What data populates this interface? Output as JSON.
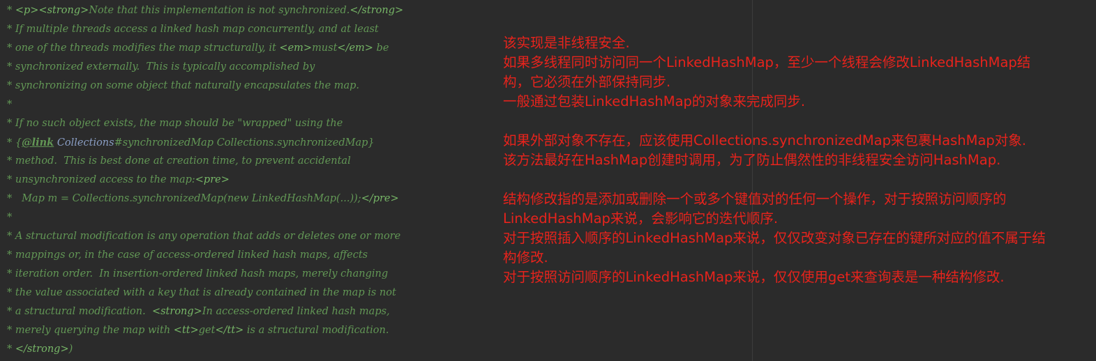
{
  "code_lines": [
    [
      "* ",
      {
        "t": "<p>",
        "c": "tag"
      },
      {
        "t": "<strong>",
        "c": "tag"
      },
      "Note that this implementation is not synchronized.",
      {
        "t": "</strong>",
        "c": "tag"
      }
    ],
    [
      "* If multiple threads access a linked hash map concurrently, and at least"
    ],
    [
      "* one of the threads modifies the map structurally, it ",
      {
        "t": "<em>",
        "c": "tag"
      },
      "must",
      {
        "t": "</em>",
        "c": "tag"
      },
      " be"
    ],
    [
      "* synchronized externally.  This is typically accomplished by"
    ],
    [
      "* synchronizing on some object that naturally encapsulates the map."
    ],
    [
      "*"
    ],
    [
      "* If no such object exists, the map should be \"wrapped\" using the"
    ],
    [
      "* {",
      {
        "t": "@link",
        "c": "linktag"
      },
      " ",
      {
        "t": "Collections",
        "c": "ref"
      },
      "#synchronizedMap Collections.synchronizedMap}"
    ],
    [
      "* method.  This is best done at creation time, to prevent accidental"
    ],
    [
      "* unsynchronized access to the map:",
      {
        "t": "<pre>",
        "c": "tag"
      }
    ],
    [
      "*   Map m = Collections.synchronizedMap(new LinkedHashMap(...));",
      {
        "t": "</pre>",
        "c": "tag"
      }
    ],
    [
      "*"
    ],
    [
      "* A structural modification is any operation that adds or deletes one or more"
    ],
    [
      "* mappings or, in the case of access-ordered linked hash maps, affects"
    ],
    [
      "* iteration order.  In insertion-ordered linked hash maps, merely changing"
    ],
    [
      "* the value associated with a key that is already contained in the map is not"
    ],
    [
      "* a structural modification.  ",
      {
        "t": "<strong>",
        "c": "tag"
      },
      "In access-ordered linked hash maps,"
    ],
    [
      "* merely querying the map with ",
      {
        "t": "<tt>",
        "c": "tag"
      },
      "get",
      {
        "t": "</tt>",
        "c": "tag"
      },
      " is a structural modification."
    ],
    [
      "* ",
      {
        "t": "</strong>",
        "c": "tag"
      },
      ")"
    ]
  ],
  "annotation_lines": [
    "该实现是非线程安全.",
    "如果多线程同时访问同一个LinkedHashMap，至少一个线程会修改LinkedHashMap结",
    "构，它必须在外部保持同步.",
    "一般通过包装LinkedHashMap的对象来完成同步.",
    "",
    "如果外部对象不存在，应该使用Collections.synchronizedMap来包裹HashMap对象.",
    "该方法最好在HashMap创建时调用，为了防止偶然性的非线程安全访问HashMap.",
    "",
    "结构修改指的是添加或删除一个或多个键值对的任何一个操作，对于按照访问顺序的",
    "LinkedHashMap来说，会影响它的迭代顺序.",
    "对于按照插入顺序的LinkedHashMap来说，仅仅改变对象已存在的键所对应的值不属于结",
    "构修改.",
    "对于按照访问顺序的LinkedHashMap来说，仅仅使用get来查询表是一种结构修改."
  ],
  "colors": {
    "background": "#2b2b2b",
    "comment_text": "#629755",
    "doc_tag": "#77b767",
    "annotation_text": "#e8231c"
  }
}
